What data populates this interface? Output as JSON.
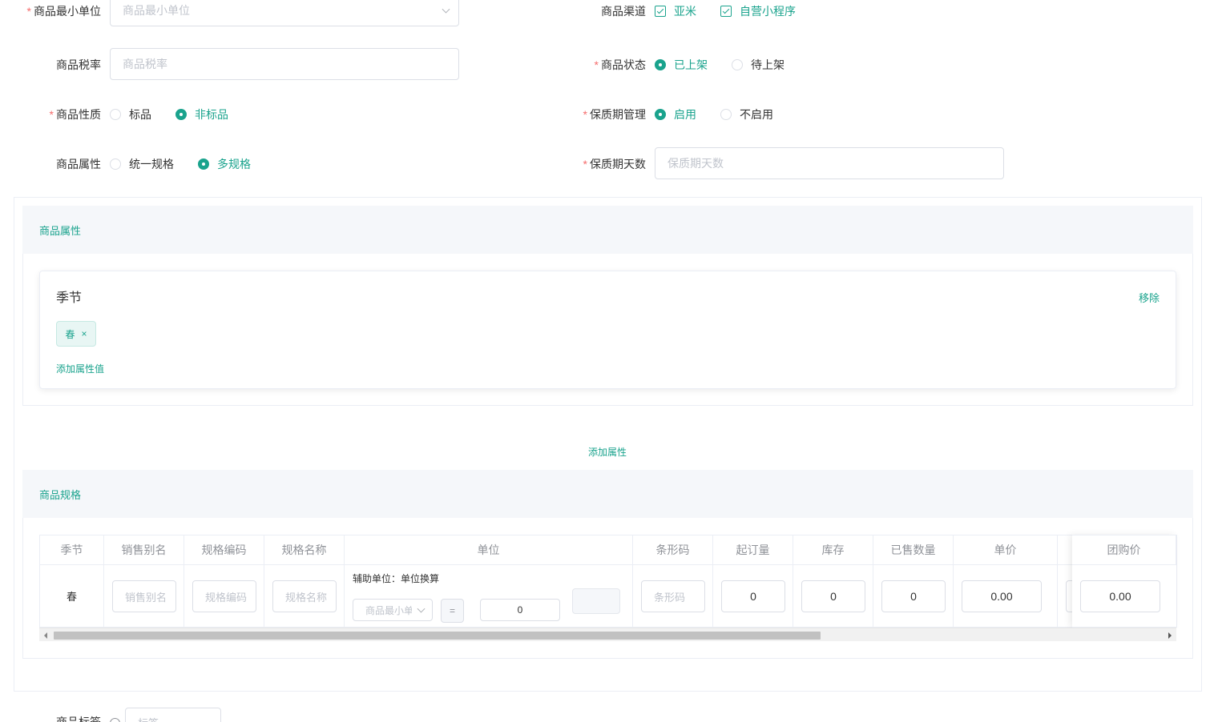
{
  "form": {
    "min_unit": {
      "label": "商品最小单位",
      "placeholder": "商品最小单位",
      "required": true
    },
    "tax_rate": {
      "label": "商品税率",
      "placeholder": "商品税率"
    },
    "nature": {
      "label": "商品性质",
      "options": [
        "标品",
        "非标品"
      ],
      "selected": "非标品"
    },
    "attribute": {
      "label": "商品属性",
      "options": [
        "统一规格",
        "多规格"
      ],
      "selected": "多规格"
    },
    "channel": {
      "label": "商品渠道",
      "options": [
        "亚米",
        "自营小程序"
      ],
      "checked": [
        "亚米",
        "自营小程序"
      ]
    },
    "status": {
      "label": "商品状态",
      "options": [
        "已上架",
        "待上架"
      ],
      "selected": "已上架"
    },
    "shelf_mgmt": {
      "label": "保质期管理",
      "options": [
        "启用",
        "不启用"
      ],
      "selected": "启用"
    },
    "shelf_days": {
      "label": "保质期天数",
      "placeholder": "保质期天数"
    },
    "tags": {
      "label": "商品标签",
      "placeholder": "标签"
    }
  },
  "attr_section": {
    "title": "商品属性",
    "card": {
      "name": "季节",
      "remove": "移除",
      "values": [
        "春"
      ],
      "add_value": "添加属性值"
    },
    "add_attr": "添加属性"
  },
  "spec_section": {
    "title": "商品规格",
    "columns": [
      "季节",
      "销售别名",
      "规格编码",
      "规格名称",
      "单位",
      "条形码",
      "起订量",
      "库存",
      "已售数量",
      "单价",
      "团购价"
    ],
    "row": {
      "season": "春",
      "alias_placeholder": "销售别名",
      "code_placeholder": "规格编码",
      "name_placeholder": "规格名称",
      "aux_unit_label": "辅助单位：单位换算",
      "unit_select_placeholder": "商品最小单位",
      "equals": "=",
      "unit_qty": "0",
      "barcode_placeholder": "条形码",
      "min_order": "0",
      "stock": "0",
      "sold": "0",
      "price": "0.00",
      "group_price": "0.00"
    }
  },
  "colors": {
    "accent": "#1aa38d",
    "required": "#f56c6c",
    "border": "#dcdfe6"
  }
}
